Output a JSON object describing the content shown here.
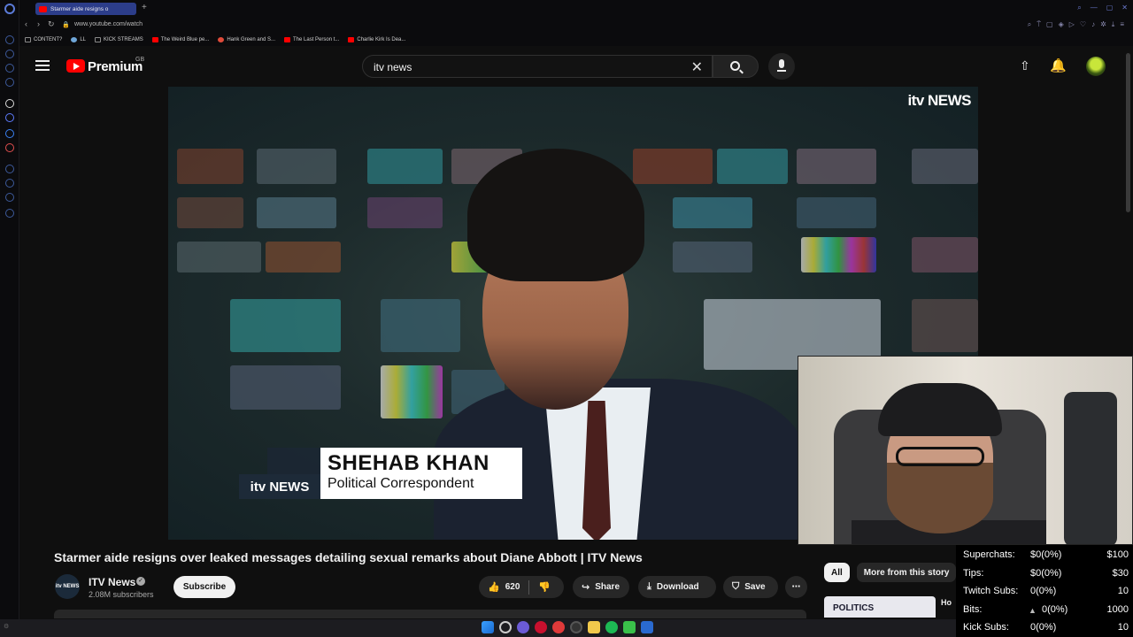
{
  "browser": {
    "tab_title": "Starmer aide resigns o",
    "new_tab": "+",
    "url": "www.youtube.com/watch",
    "bookmarks": [
      {
        "label": "CONTENT?",
        "color": "#8a8a8a"
      },
      {
        "label": "LL",
        "color": "#6fa6d8"
      },
      {
        "label": "KICK STREAMS",
        "color": "#8a8a8a"
      },
      {
        "label": "The Weird Blue pe...",
        "color": "#ff0000"
      },
      {
        "label": "Hank Green and S...",
        "color": "#e04b3a"
      },
      {
        "label": "The Last Person t...",
        "color": "#ff0000"
      },
      {
        "label": "Charlie Kirk Is Dea...",
        "color": "#ff0000"
      }
    ]
  },
  "youtube": {
    "brand": "Premium",
    "region": "GB",
    "search_value": "itv news",
    "clear_icon": "close-icon",
    "search_icon": "search-icon",
    "mic_icon": "microphone-icon",
    "upload_icon": "upload-icon",
    "bell_icon": "bell-icon"
  },
  "video": {
    "corner_logo": "itv NEWS",
    "lower_third_logo": "itv NEWS",
    "lower_third_name": "SHEHAB KHAN",
    "lower_third_role": "Political Correspondent",
    "title": "Starmer aide resigns over leaked messages detailing sexual remarks about Diane Abbott | ITV News",
    "channel": {
      "avatar_text": "itv NEWS",
      "name": "ITV News",
      "verified": "✓",
      "subscribers": "2.08M subscribers"
    },
    "subscribe_label": "Subscribe",
    "likes": "620",
    "share_label": "Share",
    "download_label": "Download",
    "save_label": "Save",
    "more_label": "⋯"
  },
  "sidebar_chips": {
    "all": "All",
    "more_from_story": "More from this story"
  },
  "recommendation": {
    "thumb_text": "POLITICS",
    "title": "Ho"
  },
  "stats": [
    {
      "label": "Superchats:",
      "value": "$0(0%)",
      "goal": "$100"
    },
    {
      "label": "Tips:",
      "value": "$0(0%)",
      "goal": "$30"
    },
    {
      "label": "Twitch Subs:",
      "value": "0(0%)",
      "goal": "10"
    },
    {
      "label": "Bits:",
      "value": "0(0%)",
      "goal": "1000"
    },
    {
      "label": "Kick Subs:",
      "value": "0(0%)",
      "goal": "10"
    }
  ]
}
